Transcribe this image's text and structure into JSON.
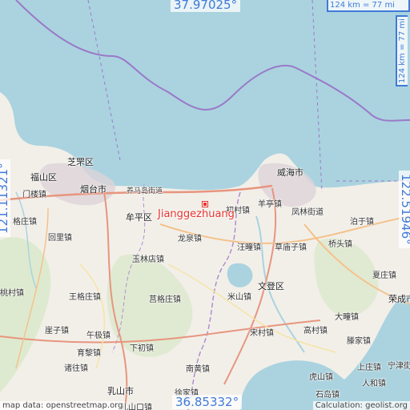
{
  "map": {
    "marker_label": "Jianggezhuang",
    "coords": {
      "top": "37.97025°",
      "bottom": "36.85332°",
      "left": "121.11321°",
      "right": "122.51946°"
    },
    "scale": {
      "horizontal": "124 km = 77 mi",
      "vertical": "124 km = 77 mi"
    },
    "attribution": "map data: openstreetmap.org",
    "credit": "Calculation: geolist.org",
    "colors": {
      "sea": "#aad3df",
      "land": "#f2efe9",
      "boundary": "#9a79c9",
      "marker": "#e8322c",
      "overlay_text": "#3f7ad8"
    },
    "places": {
      "zhifu": "芝罘区",
      "fushan": "福山区",
      "yantai": "烟台市",
      "menlou": "门楼镇",
      "gezhuang": "格庄镇",
      "huishan": "回里镇",
      "taocun": "桃村镇",
      "wangge": "王格庄镇",
      "yazi": "崖子镇",
      "wujishan": "午极镇",
      "yulin": "育黎镇",
      "zhujia": "诸往镇",
      "rushan": "乳山市",
      "muping": "牟平区",
      "yangma": "养马岛街道",
      "longquan": "龙泉镇",
      "yulindian": "玉林店镇",
      "jiangge": "莒格庄镇",
      "xiachu": "下初镇",
      "nanhuang": "南黄镇",
      "xujia": "徐家镇",
      "rushankou": "乳山口镇",
      "weihai": "威海市",
      "yangting": "羊亭镇",
      "chucun": "初村镇",
      "fenglin": "凤林街道",
      "boyu": "泊于镇",
      "wangtuan": "汪疃镇",
      "caomiao": "草庙子镇",
      "qiaotou": "桥头镇",
      "xiazhuang": "夏庄镇",
      "wendeng": "文登区",
      "mishan": "米山镇",
      "songcun": "宋村镇",
      "gaocun": "高村镇",
      "dashu": "大疃镇",
      "tengjia": "滕家镇",
      "rongcheng": "荣成市",
      "shangzhuang": "上庄镇",
      "renhe": "宁津街道",
      "hushan": "虎山镇",
      "jiwei": "人和镇",
      "shidao": "石岛镇"
    }
  }
}
